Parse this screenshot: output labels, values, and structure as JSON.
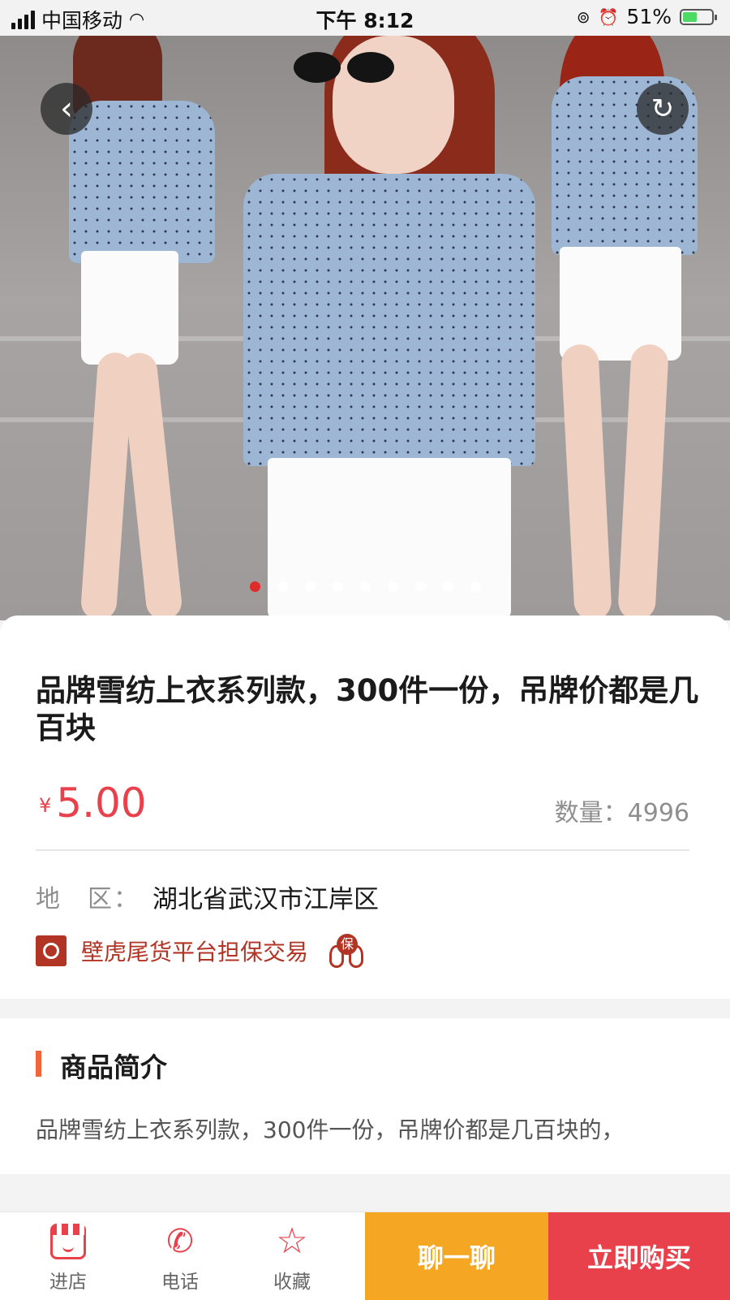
{
  "statusbar": {
    "carrier": "中国移动",
    "time": "下午 8:12",
    "battery_percent": "51%",
    "battery_level": 0.51
  },
  "gallery": {
    "image_count": 9,
    "active_index": 0
  },
  "product": {
    "title": "品牌雪纺上衣系列款，300件一份，吊牌价都是几百块",
    "currency": "¥",
    "price": "5.00",
    "quantity": "数量：4996",
    "region_label": "地　区：",
    "region_value": "湖北省武汉市江岸区",
    "guarantee_text": "壁虎尾货平台担保交易",
    "guarantee_badge": "保"
  },
  "description": {
    "heading": "商品简介",
    "text": "品牌雪纺上衣系列款，300件一份，吊牌价都是几百块的，"
  },
  "bottombar": {
    "shop_label": "进店",
    "phone_label": "电话",
    "favorite_label": "收藏",
    "chat_label": "聊一聊",
    "buy_label": "立即购买"
  },
  "colors": {
    "accent_red": "#e8414c",
    "chat_orange": "#f5a623",
    "guarantee_red": "#b23424"
  }
}
